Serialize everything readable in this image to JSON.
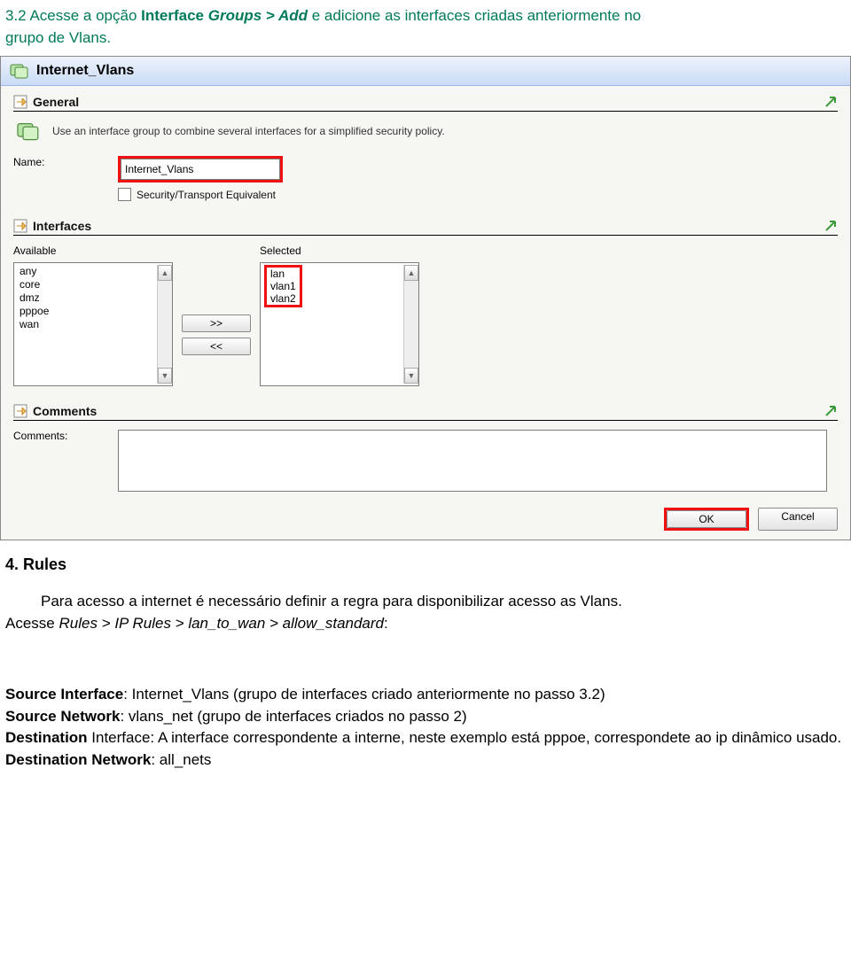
{
  "doc": {
    "intro_num": "3.2",
    "intro_l1_a": "Acesse a opção",
    "intro_l1_b": "Interface",
    "intro_l1_c": "Groups > Add",
    "intro_l1_d": "e adicione as interfaces criadas anteriormente no",
    "intro_l2": "grupo de Vlans."
  },
  "dialog": {
    "title": "Internet_Vlans",
    "general": {
      "section": "General",
      "desc": "Use an interface group to combine several interfaces for a simplified security policy.",
      "name_label": "Name:",
      "name_value": "Internet_Vlans",
      "checkbox_label": "Security/Transport Equivalent"
    },
    "interfaces": {
      "section": "Interfaces",
      "available_label": "Available",
      "available": [
        "any",
        "core",
        "dmz",
        "pppoe",
        "wan"
      ],
      "selected_label": "Selected",
      "selected": [
        "lan",
        "vlan1",
        "vlan2"
      ],
      "btn_add": ">>",
      "btn_remove": "<<"
    },
    "comments": {
      "section": "Comments",
      "label": "Comments:"
    },
    "buttons": {
      "ok": "OK",
      "cancel": "Cancel"
    }
  },
  "rules": {
    "heading": "4. Rules",
    "para1": "Para acesso a internet é necessário definir a regra para disponibilizar acesso as Vlans.",
    "acesse": "Acesse",
    "path": "Rules > IP Rules > lan_to_wan > allow_standard",
    "colon": ":",
    "fields": {
      "src_if_label": "Source Interface",
      "src_if_val": ": Internet_Vlans (grupo de interfaces criado anteriormente no passo 3.2)",
      "src_net_label": "Source Network",
      "src_net_val": ": vlans_net (grupo de interfaces criados no passo 2)",
      "dst_if_label": "Destination",
      "dst_if_rest": " Interface: A interface correspondente a interne, neste exemplo está pppoe, correspondete ao ip dinâmico usado.",
      "dst_net_label": "Destination Network",
      "dst_net_val": ": all_nets"
    }
  }
}
